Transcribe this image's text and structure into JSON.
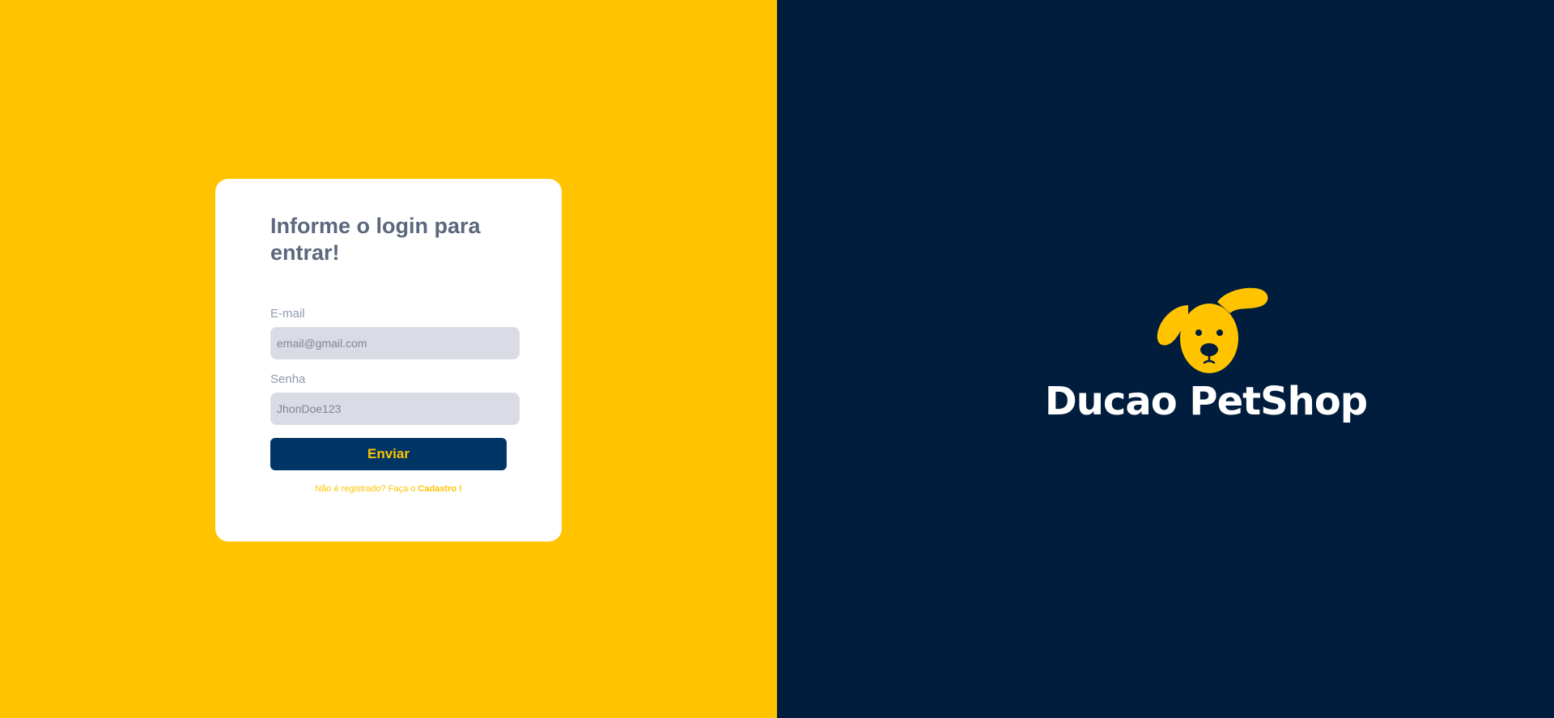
{
  "login": {
    "title": "Informe o login para entrar!",
    "email_label": "E-mail",
    "email_placeholder": "email@gmail.com",
    "password_label": "Senha",
    "password_placeholder": "JhonDoe123",
    "submit_label": "Enviar",
    "register_prompt": "Não é registrado? Faça o ",
    "register_link": "Cadastro !"
  },
  "brand": {
    "name": "Ducao PetShop",
    "logo_icon": "dog-face-icon"
  },
  "colors": {
    "yellow": "#FFC300",
    "navy": "#001D3D",
    "button": "#003566",
    "input_bg": "#D9DCE5",
    "title_text": "#5C677D"
  }
}
